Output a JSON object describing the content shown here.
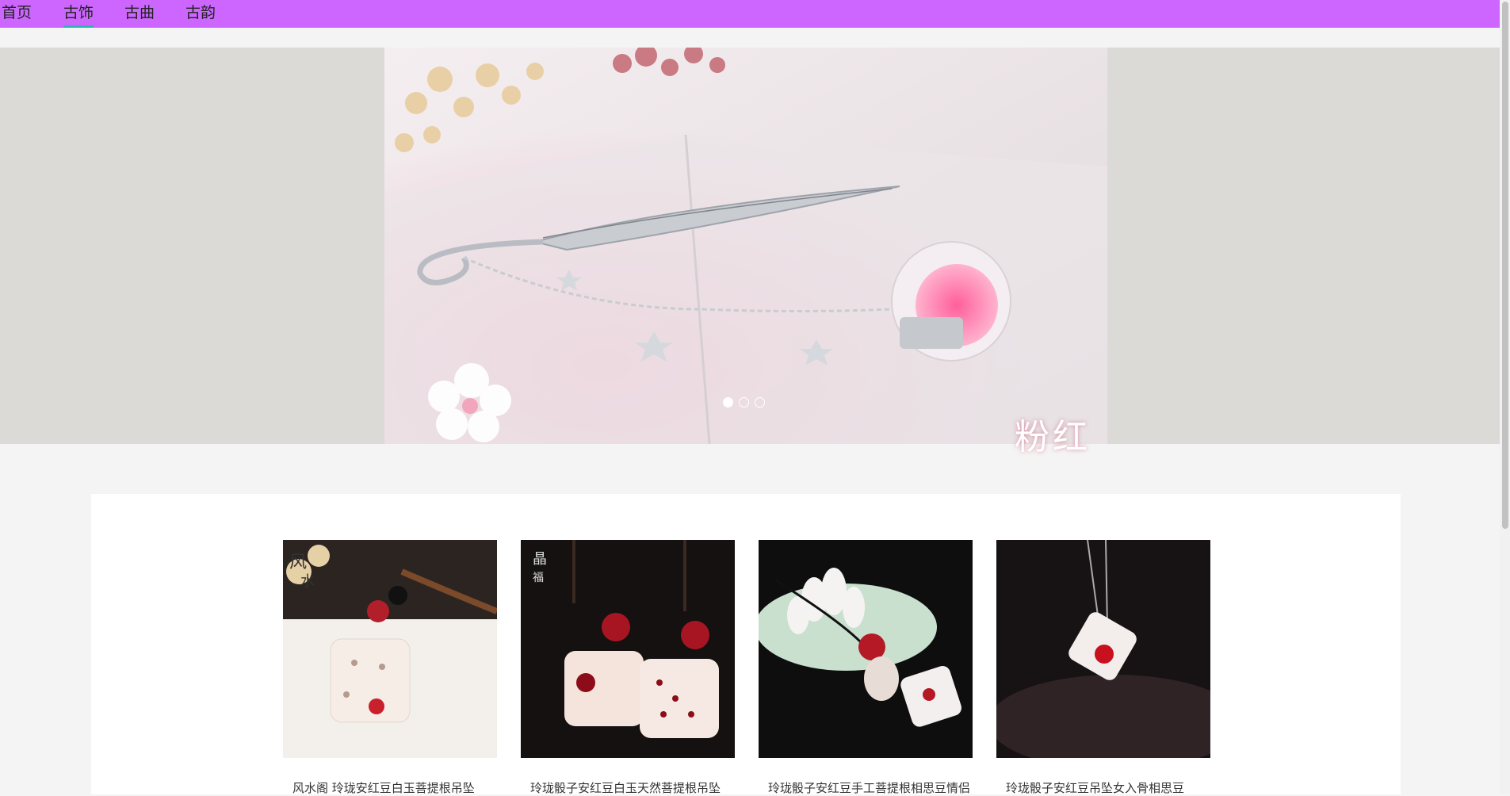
{
  "nav": {
    "items": [
      {
        "label": "首页"
      },
      {
        "label": "古饰"
      },
      {
        "label": "古曲"
      },
      {
        "label": "古韵"
      }
    ],
    "active": "古饰"
  },
  "banner": {
    "caption": "粉红",
    "slides_total": 3,
    "active_slide": 1
  },
  "products": [
    {
      "title": "风水阁 玲珑安红豆白玉菩提根吊坠",
      "image": "dice-pendant-white-background"
    },
    {
      "title": "玲珑骰子安红豆白玉天然菩提根吊坠",
      "image": "two-dice-pendants-dark-background"
    },
    {
      "title": "玲珑骰子安红豆手工菩提根相思豆情侣",
      "image": "dice-pendant-ceramic-flower"
    },
    {
      "title": "玲珑骰子安红豆吊坠女入骨相思豆",
      "image": "dice-pendant-chain-dark"
    }
  ],
  "colors": {
    "nav_bg": "#cc66ff",
    "active_underline": "#2bb5b5",
    "page_bg": "#f4f4f4"
  }
}
